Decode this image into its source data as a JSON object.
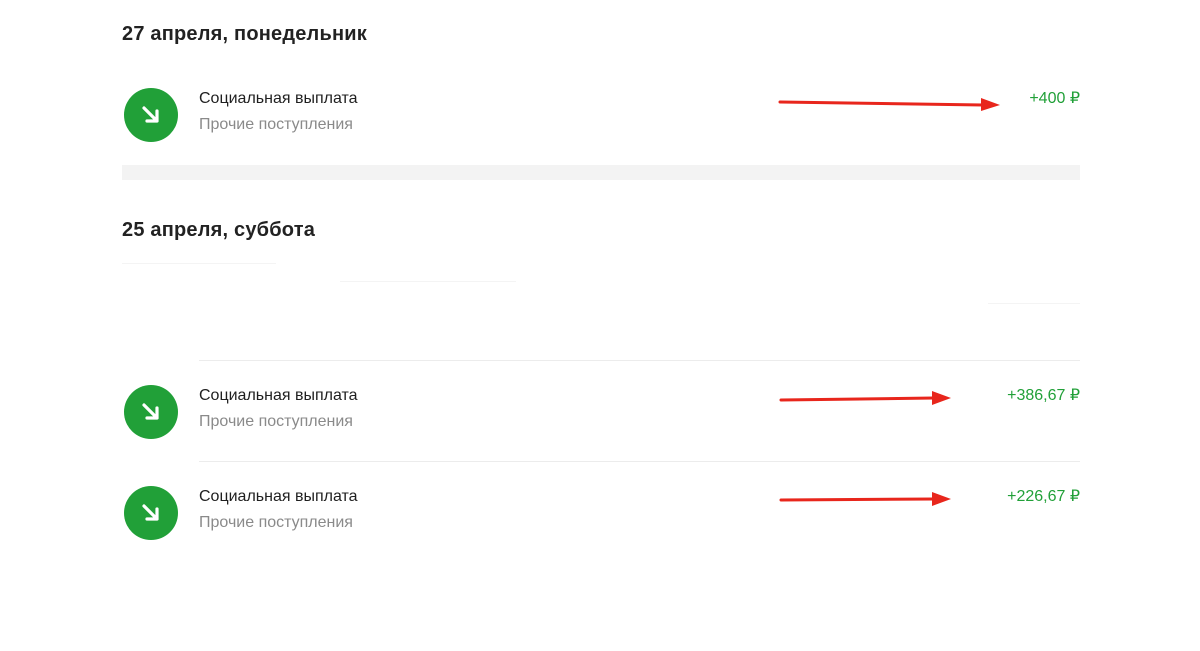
{
  "groups": [
    {
      "date": "27 апреля, понедельник",
      "transactions": [
        {
          "title": "Социальная выплата",
          "category": "Прочие поступления",
          "amount": "+400 ₽",
          "icon": "incoming-arrow-icon"
        }
      ]
    },
    {
      "date": "25 апреля, суббота",
      "transactions": [
        {
          "title": "Социальная выплата",
          "category": "Прочие поступления",
          "amount": "+386,67 ₽",
          "icon": "incoming-arrow-icon"
        },
        {
          "title": "Социальная выплата",
          "category": "Прочие поступления",
          "amount": "+226,67 ₽",
          "icon": "incoming-arrow-icon"
        }
      ]
    }
  ],
  "colors": {
    "accent_green": "#21a038",
    "annotation_red": "#e8261c",
    "muted_text": "#8a8a8a",
    "separator": "#f3f3f3"
  }
}
